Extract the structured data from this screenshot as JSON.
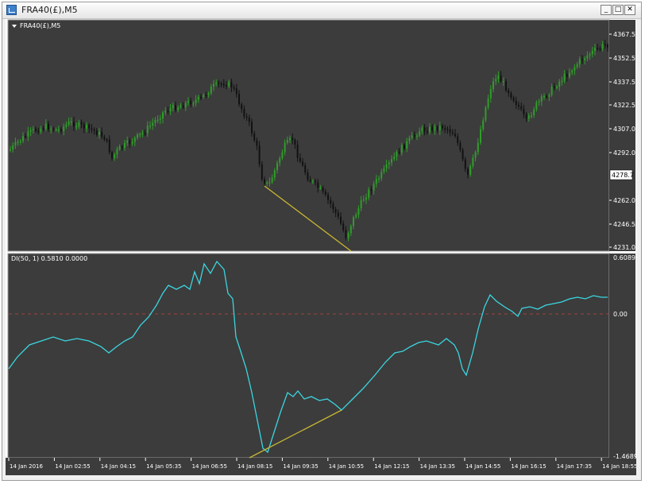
{
  "window": {
    "title": "FRA40(£),M5",
    "minimize": "_",
    "maximize": "□",
    "close": "✕"
  },
  "price_panel": {
    "label": "FRA40(£),M5",
    "y_ticks": [
      "4367.5",
      "4352.5",
      "4337.5",
      "4322.5",
      "4307.0",
      "4292.0",
      "4278.7",
      "4262.0",
      "4246.5",
      "4231.0"
    ],
    "current_price": "4278.7"
  },
  "indicator_panel": {
    "label": "DI(50, 1) 0.5810 0.0000",
    "y_ticks": [
      "0.6089",
      "0.00",
      "-1.4689"
    ]
  },
  "x_ticks": [
    "14 Jan 2016",
    "14 Jan 02:55",
    "14 Jan 04:15",
    "14 Jan 05:35",
    "14 Jan 06:55",
    "14 Jan 08:15",
    "14 Jan 09:35",
    "14 Jan 10:55",
    "14 Jan 12:15",
    "14 Jan 13:35",
    "14 Jan 14:55",
    "14 Jan 16:15",
    "14 Jan 17:35",
    "14 Jan 18:55"
  ],
  "colors": {
    "background": "#3c3c3c",
    "bull_candle": "#2f9d2a",
    "bear_candle": "#111111",
    "indicator_line": "#3ad6e0",
    "divergence_line": "#c8b632",
    "zero_line": "#a04040",
    "grid_text": "#ffffff"
  }
}
